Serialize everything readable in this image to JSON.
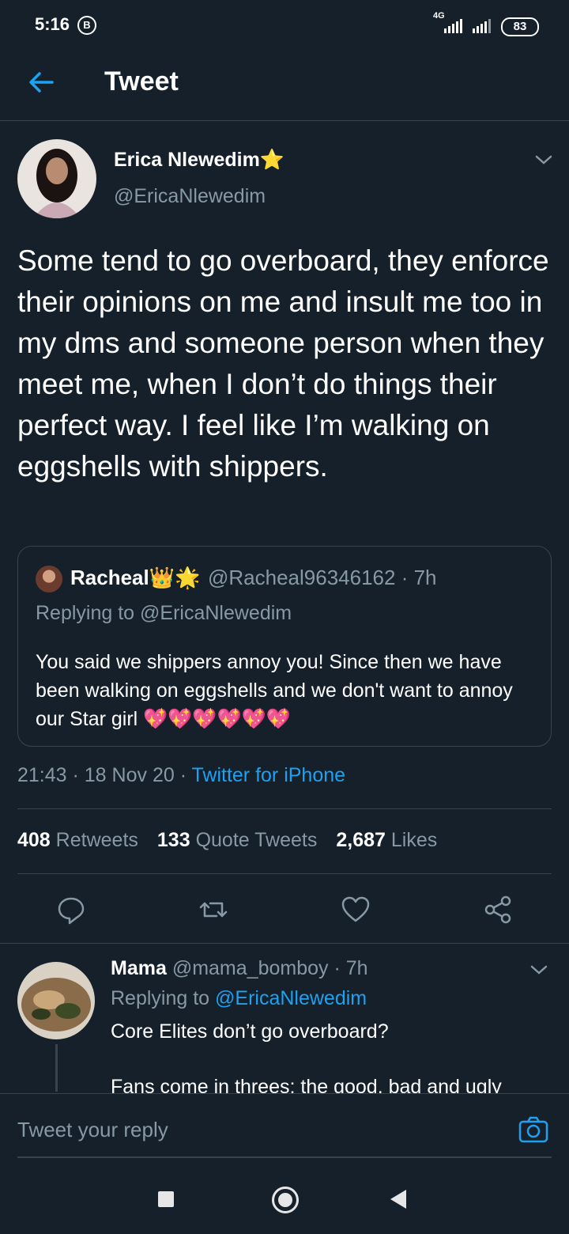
{
  "status_bar": {
    "time": "5:16",
    "b_badge": "B",
    "network": "4G",
    "battery": "83"
  },
  "header": {
    "title": "Tweet"
  },
  "tweet": {
    "author_name": "Erica Nlewedim",
    "author_badge": "⭐",
    "handle": "@EricaNlewedim",
    "text": "Some tend to go overboard, they enforce their opinions on me and insult me too in my dms and someone person when they meet me, when I don’t do things their perfect way. I feel like I’m walking on eggshells with shippers.",
    "time": "21:43",
    "date": "18 Nov 20",
    "source": "Twitter for iPhone",
    "retweets": "408",
    "retweets_label": "Retweets",
    "quotes": "133",
    "quotes_label": "Quote Tweets",
    "likes": "2,687",
    "likes_label": "Likes"
  },
  "quoted": {
    "name": "Racheal",
    "name_emoji": "👑🌟",
    "handle_time": "@Racheal96346162 · 7h",
    "replying_to": "Replying to @EricaNlewedim",
    "text": "You said we shippers annoy you! Since then we have been walking on eggshells and we don't want to annoy our Star girl 💖💖💖💖💖💖"
  },
  "reply": {
    "name": "Mama",
    "handle_time": "@mama_bomboy · 7h",
    "replying_label": "Replying to",
    "replying_handle": "@EricaNlewedim",
    "text": "Core Elites don’t go overboard?",
    "text_more": "Fans come in threes; the good, bad and ugly"
  },
  "compose": {
    "placeholder": "Tweet your reply"
  },
  "colors": {
    "background": "#15202b",
    "accent": "#1da1f2",
    "muted": "#8899a6",
    "border": "#38444d"
  }
}
